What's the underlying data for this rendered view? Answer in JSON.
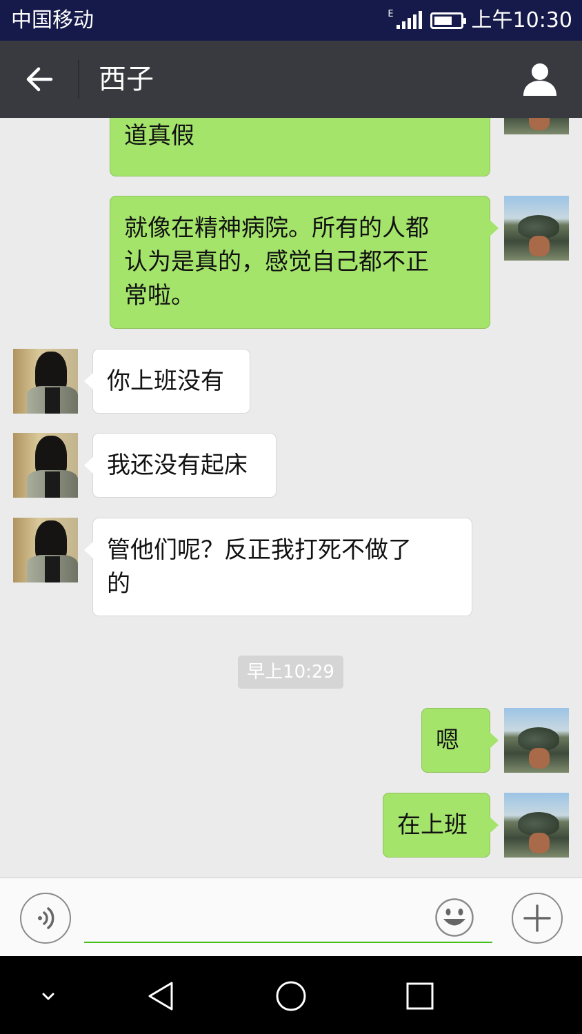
{
  "status_bar": {
    "carrier": "中国移动",
    "network_type": "E",
    "battery_percent": 70,
    "time": "上午10:30"
  },
  "header": {
    "title": "西子",
    "back_icon": "arrow-left-icon",
    "profile_icon": "person-icon"
  },
  "messages": [
    {
      "direction": "out",
      "text": "真真假假，谁没有的人也不知\n道真假"
    },
    {
      "direction": "out",
      "text": "就像在精神病院。所有的人都\n认为是真的，感觉自己都不正\n常啦。"
    },
    {
      "direction": "in",
      "text": "你上班没有"
    },
    {
      "direction": "in",
      "text": "我还没有起床"
    },
    {
      "direction": "in",
      "text": "管他们呢？反正我打死不做了\n的"
    },
    {
      "direction": "out",
      "text": "嗯"
    },
    {
      "direction": "out",
      "text": "在上班"
    }
  ],
  "timestamp": "早上10:29",
  "input_bar": {
    "placeholder": "",
    "voice_icon": "voice-icon",
    "emoji_icon": "emoji-icon",
    "plus_icon": "plus-icon"
  },
  "colors": {
    "status_bar": "#161a4a",
    "header": "#393a3f",
    "outgoing_bubble": "#a4e46b",
    "incoming_bubble": "#ffffff",
    "chat_background": "#ebebeb",
    "input_underline": "#45c01a"
  }
}
